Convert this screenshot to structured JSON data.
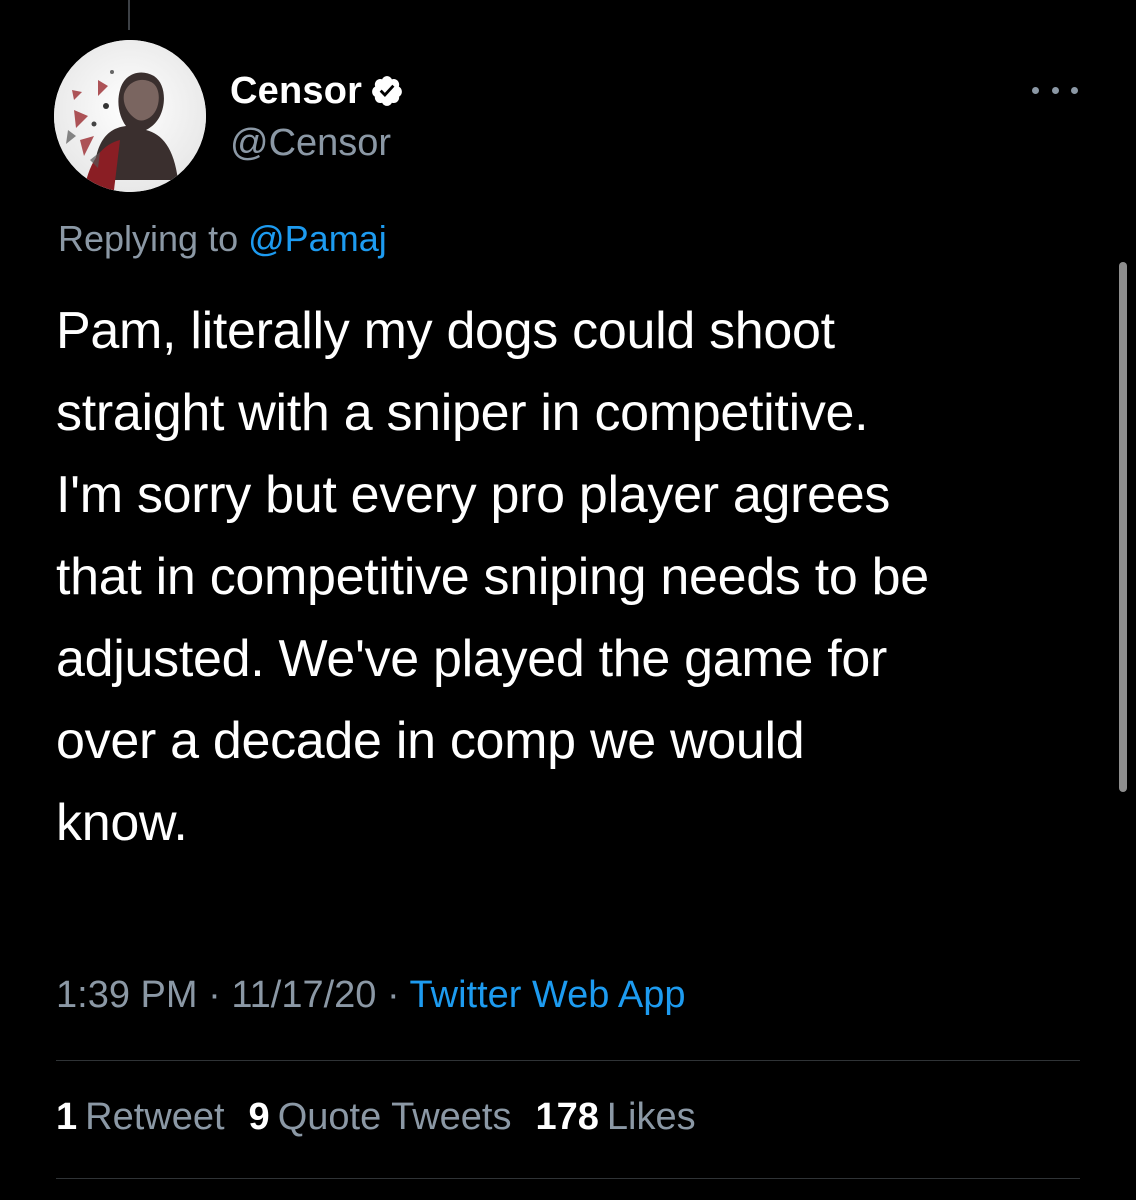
{
  "tweet": {
    "author": {
      "display_name": "Censor",
      "handle": "@Censor",
      "verified": true,
      "avatar_icon": "avatar-photo"
    },
    "more_icon": "more-horizontal-icon",
    "replying_prefix": "Replying to",
    "replying_to": "@Pamaj",
    "text_lines": [
      "Pam, literally my dogs could shoot",
      "straight with a sniper in competitive.",
      "I'm sorry but every pro player agrees",
      "that in competitive sniping needs to be",
      "adjusted. We've played the game for",
      "over a decade in comp we would",
      "know."
    ],
    "time": "1:39 PM",
    "separator": "·",
    "date": "11/17/20",
    "source": "Twitter Web App",
    "stats": {
      "retweets": {
        "count": "1",
        "label": "Retweet"
      },
      "quotes": {
        "count": "9",
        "label": "Quote Tweets"
      },
      "likes": {
        "count": "178",
        "label": "Likes"
      }
    }
  },
  "colors": {
    "background": "#000000",
    "primary_text": "#ffffff",
    "secondary_text": "#8b98a5",
    "link": "#1d9bf0",
    "divider": "#2f3336"
  }
}
